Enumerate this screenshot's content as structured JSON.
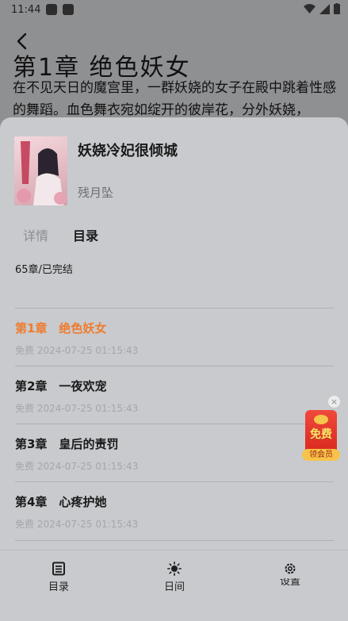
{
  "status_bar": {
    "time": "11:44"
  },
  "reader": {
    "chapter_heading": "第1章  绝色妖女",
    "paragraph": "在不见天日的魔宫里，一群妖娆的女子在殿中跳着性感的舞蹈。血色舞衣宛如绽开的彼岸花，分外妖娆，"
  },
  "book": {
    "title": "妖娆冷妃很倾城",
    "author": "残月坠"
  },
  "tabs": {
    "details": "详情",
    "toc": "目录"
  },
  "chapter_count": "65章/已完结",
  "chapters": [
    {
      "title": "第1章　绝色妖女",
      "meta": "免费 2024-07-25 01:15:43"
    },
    {
      "title": "第2章　一夜欢宠",
      "meta": "免费 2024-07-25 01:15:43"
    },
    {
      "title": "第3章　皇后的责罚",
      "meta": "免费 2024-07-25 01:15:43"
    },
    {
      "title": "第4章　心疼护她",
      "meta": "免费 2024-07-25 01:15:43"
    }
  ],
  "promo": {
    "label": "免费",
    "cta": "领会员",
    "close": "×"
  },
  "bottom_nav": {
    "toc": "目录",
    "daynight": "日间",
    "settings": "设置"
  },
  "colors": {
    "accent": "#f07a2c",
    "sheet_bg": "#c8cacd"
  }
}
